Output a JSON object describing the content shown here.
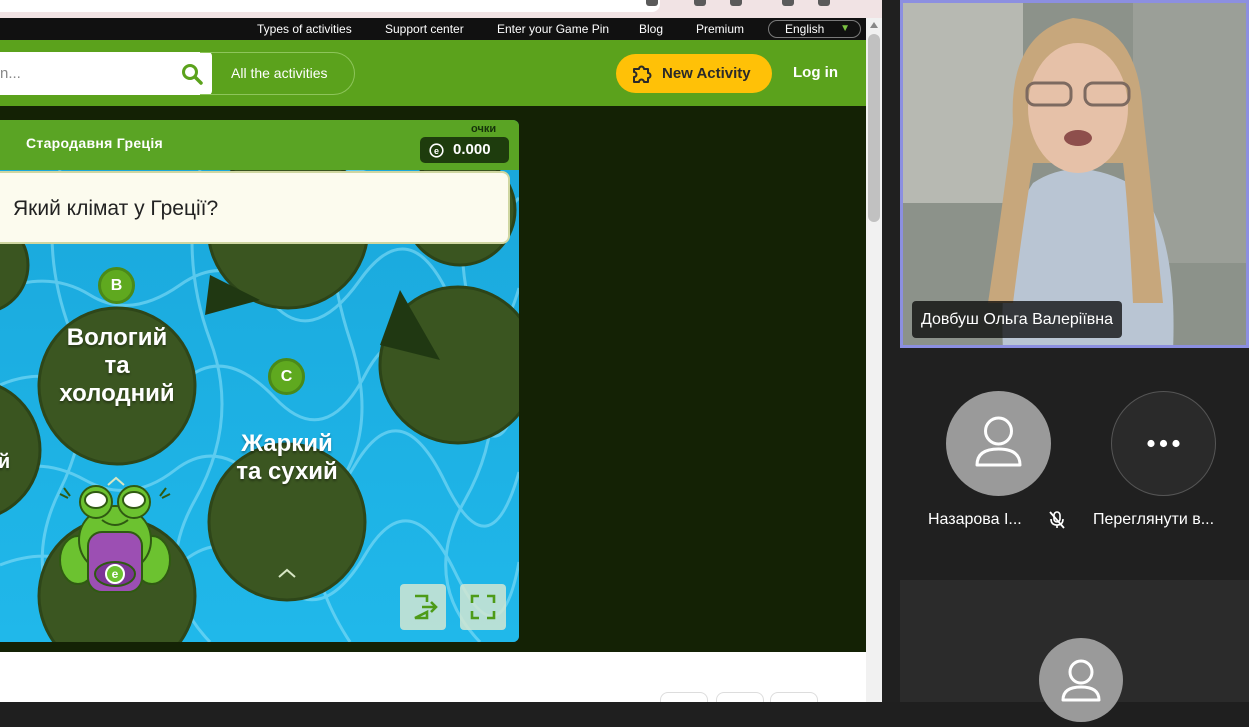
{
  "browser": {
    "topnav": {
      "items": [
        "Types of activities",
        "Support center",
        "Enter your Game Pin",
        "Blog",
        "Premium"
      ],
      "language": "English"
    },
    "header": {
      "search_placeholder": "n...",
      "all_activities": "All the activities",
      "new_activity": "New Activity",
      "login": "Log in"
    },
    "game": {
      "title": "Стародавня Греція",
      "score_label": "очки",
      "score_value": "0.000",
      "question": "Який клімат у Греції?",
      "answers": [
        {
          "letter": "B",
          "line1": "Вологий",
          "line2": "та",
          "line3": "холодний"
        },
        {
          "letter": "C",
          "line1": "Жаркий",
          "line2": "та сухий",
          "line3": ""
        }
      ],
      "partial_answer": "й",
      "frog_badge": "e"
    }
  },
  "meeting": {
    "speaker_name": "Довбуш Ольга Валеріївна",
    "participants": [
      {
        "name": "Назарова І...",
        "muted": true
      },
      {
        "name": "Переглянути в..."
      }
    ]
  },
  "colors": {
    "accent_green": "#5ba21c",
    "new_activity_yellow": "#ffc107",
    "water_blue": "#1e8fc9",
    "speaker_border": "#8c8fe0"
  }
}
